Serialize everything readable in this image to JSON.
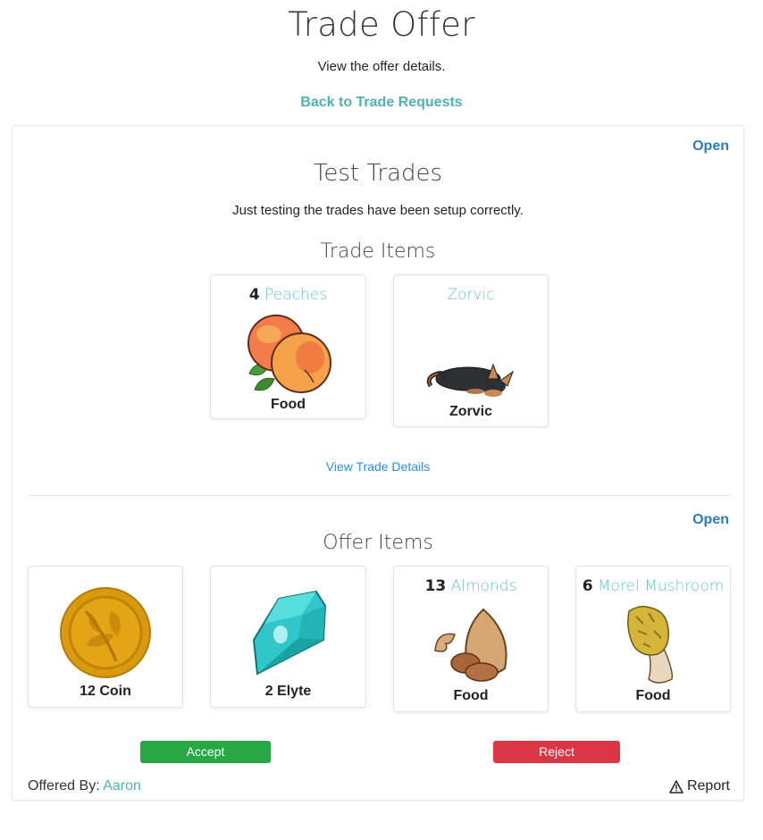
{
  "header": {
    "title": "Trade Offer",
    "subtitle": "View the offer details.",
    "back_link": "Back to Trade Requests"
  },
  "trade": {
    "status": "Open",
    "title": "Test Trades",
    "description": "Just testing the trades have been setup correctly.",
    "section_title": "Trade Items",
    "items": [
      {
        "quantity": "4",
        "name": "Peaches",
        "footer": "Food",
        "icon": "peaches-image"
      },
      {
        "quantity": "",
        "name": "Zorvic",
        "footer": "Zorvic",
        "icon": "zorvic-pet-image"
      }
    ],
    "view_details": "View Trade Details"
  },
  "offer": {
    "status": "Open",
    "section_title": "Offer Items",
    "items": [
      {
        "quantity": "",
        "name": "",
        "footer": "12 Coin",
        "icon": "coin-image"
      },
      {
        "quantity": "",
        "name": "",
        "footer": "2 Elyte",
        "icon": "elyte-gem-image"
      },
      {
        "quantity": "13",
        "name": "Almonds",
        "footer": "Food",
        "icon": "almonds-image"
      },
      {
        "quantity": "6",
        "name": "Morel Mushroom",
        "footer": "Food",
        "icon": "morel-mushroom-image"
      }
    ],
    "accept_label": "Accept",
    "reject_label": "Reject",
    "offered_by_label": "Offered By:",
    "offered_by_user": "Aaron",
    "report_label": "Report"
  },
  "colors": {
    "accent_teal": "#4fb2b5",
    "status_blue": "#2f7bb3",
    "link_blue": "#2b8fe0",
    "accept_green": "#28a745",
    "reject_red": "#dc3545"
  }
}
